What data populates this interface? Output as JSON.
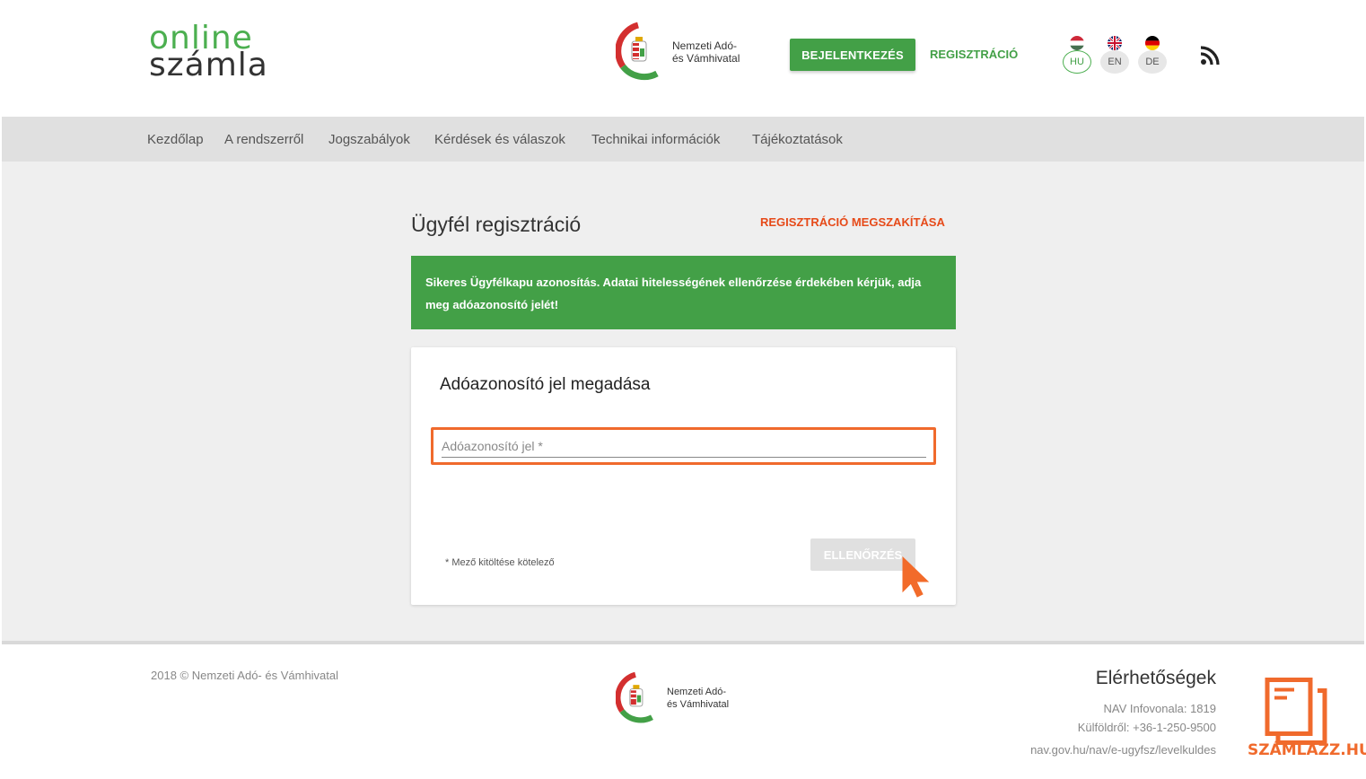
{
  "header": {
    "logo_line1": "online",
    "logo_line2": "számla",
    "nav_name_line1": "Nemzeti Adó-",
    "nav_name_line2": "és Vámhivatal",
    "login_label": "BEJELENTKEZÉS",
    "register_label": "REGISZTRÁCIÓ",
    "languages": [
      {
        "code": "HU",
        "active": true
      },
      {
        "code": "EN",
        "active": false
      },
      {
        "code": "DE",
        "active": false
      }
    ],
    "rss_icon": "rss-icon"
  },
  "navbar": {
    "items": [
      "Kezdőlap",
      "A rendszerről",
      "Jogszabályok",
      "Kérdések és válaszok",
      "Technikai információk",
      "Tájékoztatások"
    ]
  },
  "main": {
    "title": "Ügyfél regisztráció",
    "cancel_label": "REGISZTRÁCIÓ MEGSZAKÍTÁSA",
    "alert_text": "Sikeres Ügyfélkapu azonosítás. Adatai hitelességének ellenőrzése érdekében kérjük, adja meg adóazonosító jelét!",
    "card": {
      "title": "Adóazonosító jel megadása",
      "input_placeholder": "Adóazonosító jel *",
      "input_value": "",
      "required_note": "* Mező kitöltése kötelező",
      "check_button": "ELLENŐRZÉS"
    }
  },
  "footer": {
    "copyright": "2018 © Nemzeti Adó- és Vámhivatal",
    "nav_name_line1": "Nemzeti Adó-",
    "nav_name_line2": "és Vámhivatal",
    "contacts_title": "Elérhetőségek",
    "contacts": [
      "NAV Infovonala: 1819",
      "Külföldről: +36-1-250-9500",
      "nav.gov.hu/nav/e-ugyfsz/levelkuldes"
    ],
    "brand": "SZÁMLÁZZ.HU"
  },
  "colors": {
    "brand_green": "#43a047",
    "accent_orange": "#f06a2c",
    "cancel_red": "#e64a19"
  }
}
